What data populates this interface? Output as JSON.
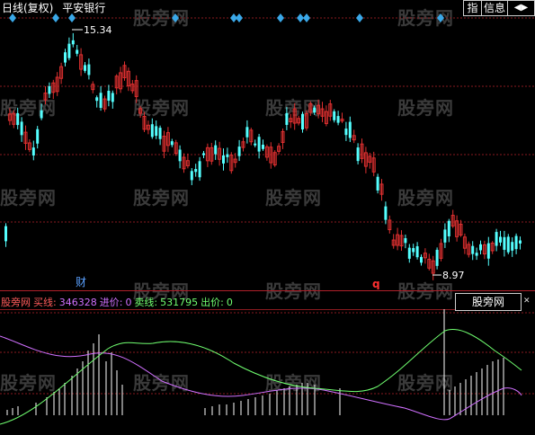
{
  "header": {
    "chart_type": "日线(复权)",
    "stock_name": "平安银行",
    "buttons": [
      "指",
      "信息",
      "◀▶"
    ]
  },
  "main": {
    "high_label": "15.34",
    "low_label": "8.97",
    "marker_cai": "财",
    "marker_q": "q",
    "up_color": "#e03030",
    "down_color": "#54ffff",
    "diamond_color": "#3aa8e8"
  },
  "indicator": {
    "name": "股旁网",
    "buy_label": "买线:",
    "buy_value": "346328",
    "entry_label": "进价:",
    "entry_value": "0",
    "sell_label": "卖线:",
    "sell_value": "531795",
    "exit_label": "出价:",
    "exit_value": "0",
    "box_label": "股旁网",
    "colors": {
      "name": "#ff5b5b",
      "buy": "#d070ff",
      "sell": "#70ff70",
      "exit": "#70ff70"
    }
  },
  "watermark": "股旁网"
}
